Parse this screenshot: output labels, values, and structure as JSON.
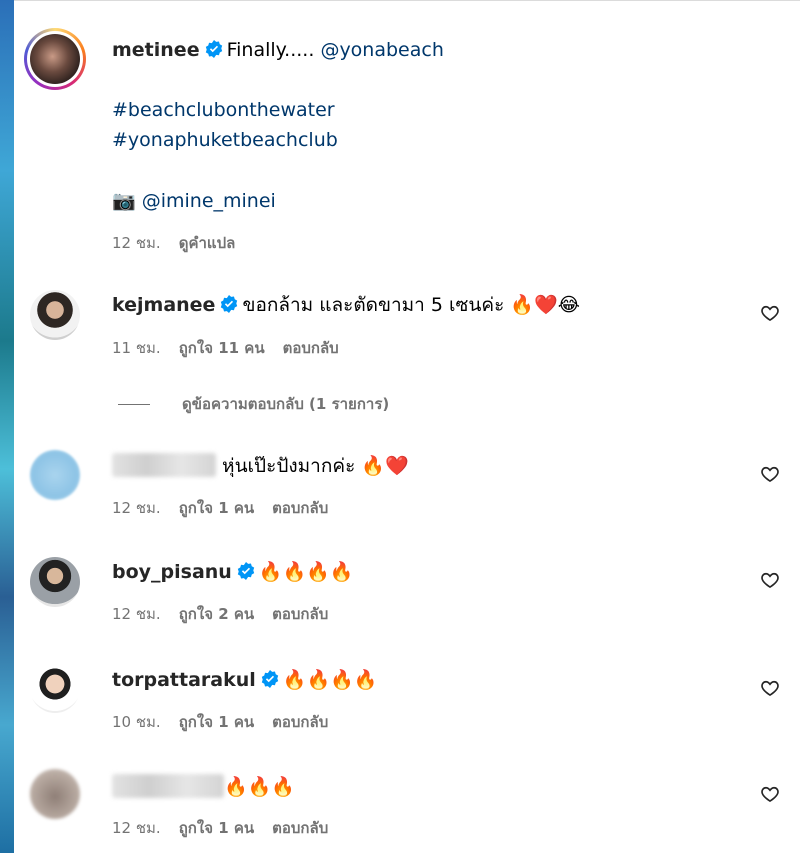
{
  "caption": {
    "username": "metinee",
    "text_prefix": "Finally.....",
    "mention": "@yonabeach",
    "hashtags": [
      "#beachclubonthewater",
      "#yonaphuketbeachclub"
    ],
    "camera_emoji": "📷",
    "photo_credit": "@imine_minei",
    "time": "12 ชม.",
    "translate": "ดูคำแปล"
  },
  "comments": [
    {
      "username": "kejmanee",
      "verified": true,
      "text": "ขอกล้าม และตัดขามา 5 เซนค่ะ",
      "emojis": "🔥❤️😂",
      "time": "11 ชม.",
      "likes": "ถูกใจ 11 คน",
      "reply": "ตอบกลับ"
    },
    {
      "username": "",
      "verified": false,
      "text": "หุ่นเป๊ะปังมากค่ะ",
      "emojis": "🔥❤️",
      "time": "12 ชม.",
      "likes": "ถูกใจ 1 คน",
      "reply": "ตอบกลับ"
    },
    {
      "username": "boy_pisanu",
      "verified": true,
      "text": "",
      "emojis": "🔥🔥🔥🔥",
      "time": "12 ชม.",
      "likes": "ถูกใจ 2 คน",
      "reply": "ตอบกลับ"
    },
    {
      "username": "torpattarakul",
      "verified": true,
      "text": "",
      "emojis": "🔥🔥🔥🔥",
      "time": "10 ชม.",
      "likes": "ถูกใจ 1 คน",
      "reply": "ตอบกลับ"
    },
    {
      "username": "",
      "verified": false,
      "text": "",
      "emojis": "🔥🔥🔥",
      "time": "12 ชม.",
      "likes": "ถูกใจ 1 คน",
      "reply": "ตอบกลับ"
    }
  ],
  "view_replies": "ดูข้อความตอบกลับ (1 รายการ)",
  "colors": {
    "link": "#00376b",
    "verified": "#0095f6",
    "meta": "#737373"
  },
  "icons": [
    "verified-badge-icon",
    "heart-outline-icon",
    "camera-icon"
  ]
}
